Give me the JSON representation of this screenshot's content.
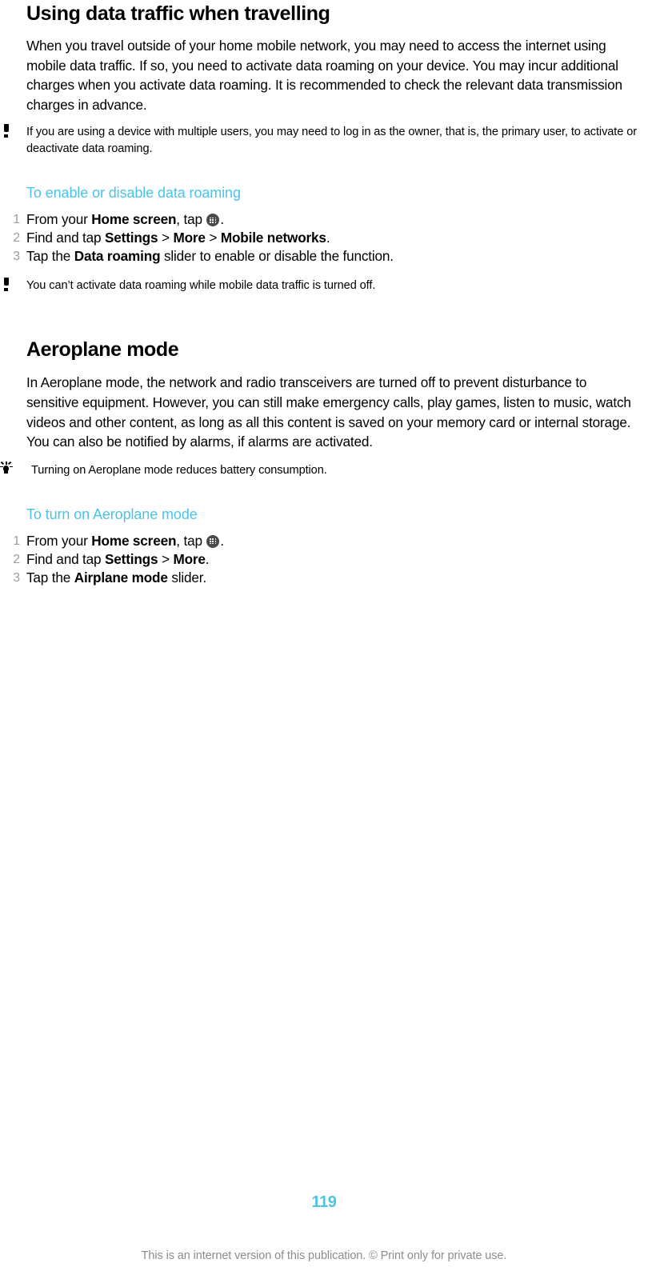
{
  "document": {
    "page_number": "119",
    "footer_note": "This is an internet version of this publication. © Print only for private use.",
    "accent_color": "#4BC3E6",
    "number_color": "#9c9c9c"
  },
  "sections": [
    {
      "title": "Using data traffic when travelling",
      "body": "When you travel outside of your home mobile network, you may need to access the internet using mobile data traffic. If so, you need to activate data roaming on your device. You may incur additional charges when you activate data roaming. It is recommended to check the relevant data transmission charges in advance.",
      "note": {
        "icon": "warning-icon",
        "text": "If you are using a device with multiple users, you may need to log in as the owner, that is, the primary user, to activate or deactivate data roaming."
      },
      "procedure": {
        "heading": "To enable or disable data roaming",
        "steps": [
          {
            "number": "1",
            "pre": "From your ",
            "bold1": "Home screen",
            "mid": ", tap ",
            "icon": "app-drawer-icon",
            "post": "."
          },
          {
            "number": "2",
            "pre": "Find and tap ",
            "bold1": "Settings",
            "sep1": " > ",
            "bold2": "More",
            "sep2": " > ",
            "bold3": "Mobile networks",
            "post": "."
          },
          {
            "number": "3",
            "pre": "Tap the ",
            "bold1": "Data roaming",
            "post": " slider to enable or disable the function."
          }
        ],
        "after_note": {
          "icon": "warning-icon",
          "text": "You can’t activate data roaming while mobile data traffic is turned off."
        }
      }
    },
    {
      "title": "Aeroplane mode",
      "body": "In Aeroplane mode, the network and radio transceivers are turned off to prevent disturbance to sensitive equipment. However, you can still make emergency calls, play games, listen to music, watch videos and other content, as long as all this content is saved on your memory card or internal storage. You can also be notified by alarms, if alarms are activated.",
      "note": {
        "icon": "tip-lightbulb-icon",
        "text": "Turning on Aeroplane mode reduces battery consumption."
      },
      "procedure": {
        "heading": "To turn on Aeroplane mode",
        "steps": [
          {
            "number": "1",
            "pre": "From your ",
            "bold1": "Home screen",
            "mid": ", tap ",
            "icon": "app-drawer-icon",
            "post": "."
          },
          {
            "number": "2",
            "pre": "Find and tap ",
            "bold1": "Settings",
            "sep1": " > ",
            "bold2": "More",
            "post": "."
          },
          {
            "number": "3",
            "pre": "Tap the ",
            "bold1": "Airplane mode",
            "post": " slider."
          }
        ]
      }
    }
  ]
}
